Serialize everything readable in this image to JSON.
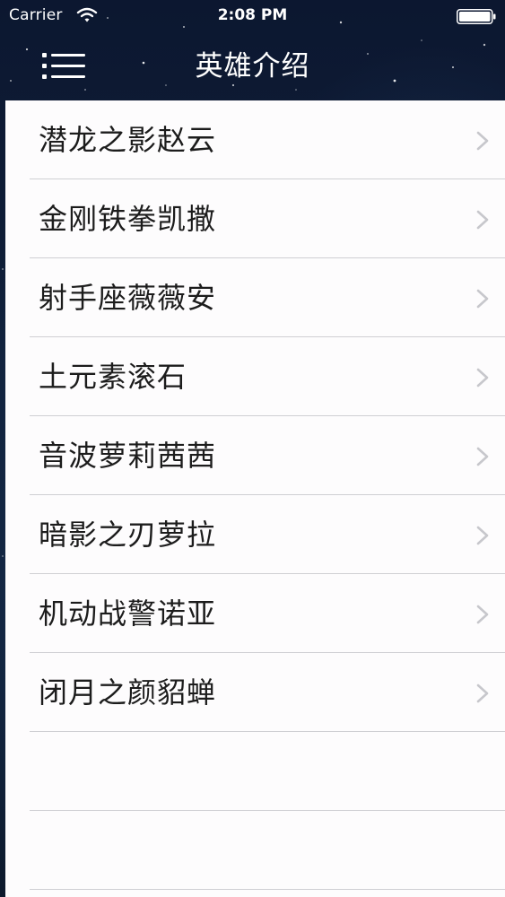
{
  "status_bar": {
    "carrier": "Carrier",
    "time": "2:08 PM"
  },
  "nav_bar": {
    "title": "英雄介绍",
    "menu_icon": "list-menu-icon"
  },
  "table": {
    "rows": [
      {
        "label": "潜龙之影赵云"
      },
      {
        "label": "金刚铁拳凯撒"
      },
      {
        "label": "射手座薇薇安"
      },
      {
        "label": "土元素滚石"
      },
      {
        "label": "音波萝莉茜茜"
      },
      {
        "label": "暗影之刃萝拉"
      },
      {
        "label": "机动战警诺亚"
      },
      {
        "label": "闭月之颜貂蝉"
      }
    ],
    "empty_rows": 2,
    "accessory_icon": "chevron-right-icon"
  },
  "colors": {
    "background": "#0c1730",
    "table_background": "#fdfcfd",
    "separator": "#cfcfd3",
    "text": "#1c1c1c",
    "chevron": "#c7c7cc"
  }
}
